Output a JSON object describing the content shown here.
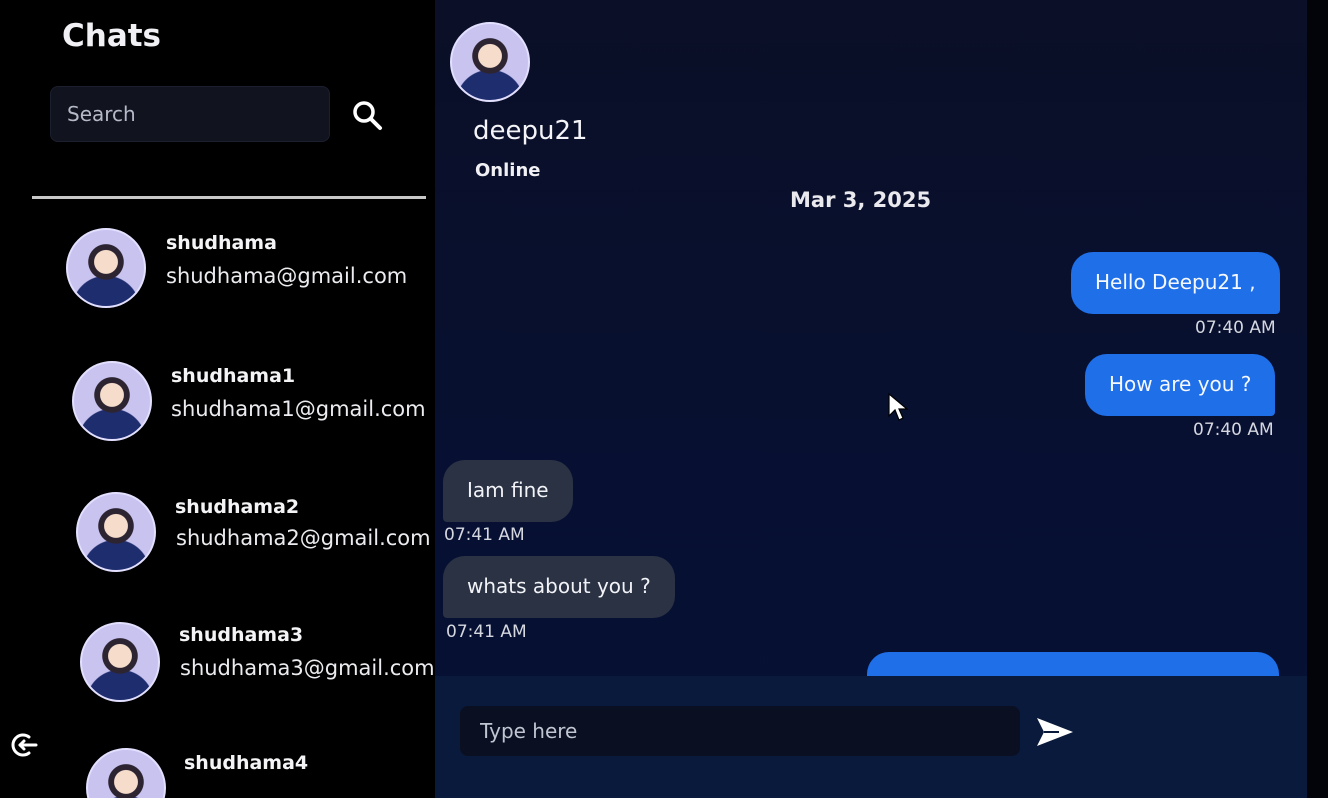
{
  "sidebar": {
    "title": "Chats",
    "search_placeholder": "Search",
    "contacts": [
      {
        "name": "shudhama",
        "email": "shudhama@gmail.com"
      },
      {
        "name": "shudhama1",
        "email": "shudhama1@gmail.com"
      },
      {
        "name": "shudhama2",
        "email": "shudhama2@gmail.com"
      },
      {
        "name": "shudhama3",
        "email": "shudhama3@gmail.com"
      },
      {
        "name": "shudhama4",
        "email": ""
      }
    ]
  },
  "chat": {
    "peer_name": "deepu21",
    "peer_status": "Online",
    "date": "Mar 3, 2025",
    "messages": [
      {
        "direction": "out",
        "text": "Hello Deepu21 ,",
        "time": "07:40 AM"
      },
      {
        "direction": "out",
        "text": "How are you ?",
        "time": "07:40 AM"
      },
      {
        "direction": "in",
        "text": "Iam fine",
        "time": "07:41 AM"
      },
      {
        "direction": "in",
        "text": "whats about you ?",
        "time": "07:41 AM"
      }
    ],
    "input_placeholder": "Type here"
  },
  "icons": {
    "search": "search-icon",
    "send": "send-icon",
    "logout": "logout-icon"
  },
  "colors": {
    "outgoing_bubble": "#1f6fe8",
    "incoming_bubble": "#2a3244",
    "background": "#0b0f27"
  }
}
